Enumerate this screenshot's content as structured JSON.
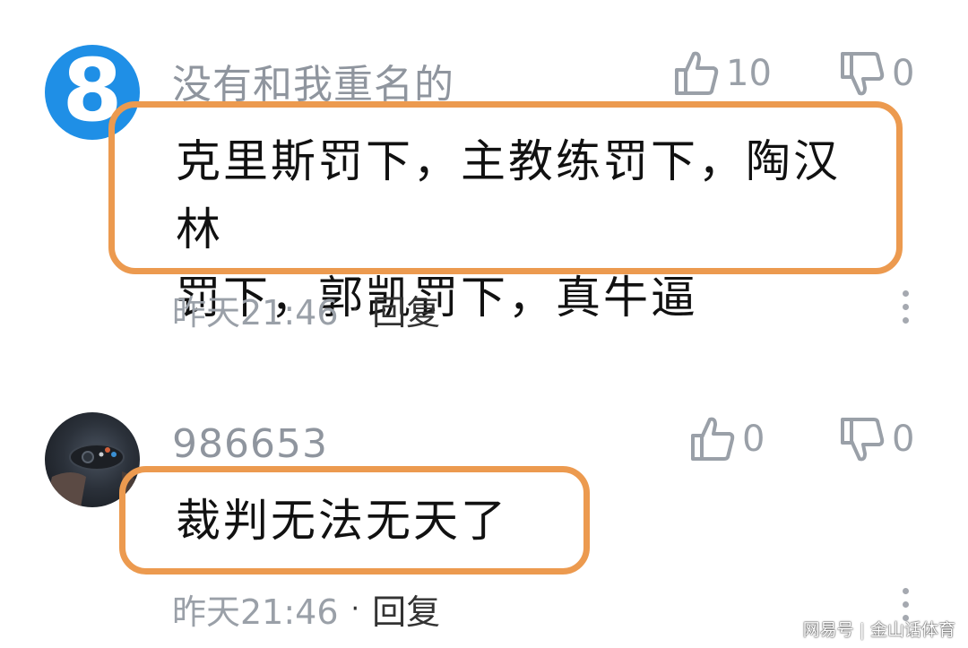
{
  "comments": [
    {
      "avatar_text": "8",
      "username": "没有和我重名的",
      "likes": "10",
      "dislikes": "0",
      "text_line1": "克里斯罚下，主教练罚下，陶汉林",
      "text_line2": "罚下，郭凯罚下，真牛逼",
      "time": "昨天21:46",
      "dot": "·",
      "reply": "回复"
    },
    {
      "username": "986653",
      "likes": "0",
      "dislikes": "0",
      "text_line1": "裁判无法无天了",
      "time": "昨天21:46",
      "dot": "·",
      "reply": "回复"
    }
  ],
  "watermark": {
    "left": "网易号",
    "sep": "|",
    "right": "金山话体育"
  },
  "colors": {
    "highlight_border": "#ec9a4f",
    "avatar_blue": "#1f8fe6",
    "muted": "#9aa0a8"
  },
  "icons": [
    "thumbs-up-icon",
    "thumbs-down-icon",
    "more-vertical-icon"
  ]
}
